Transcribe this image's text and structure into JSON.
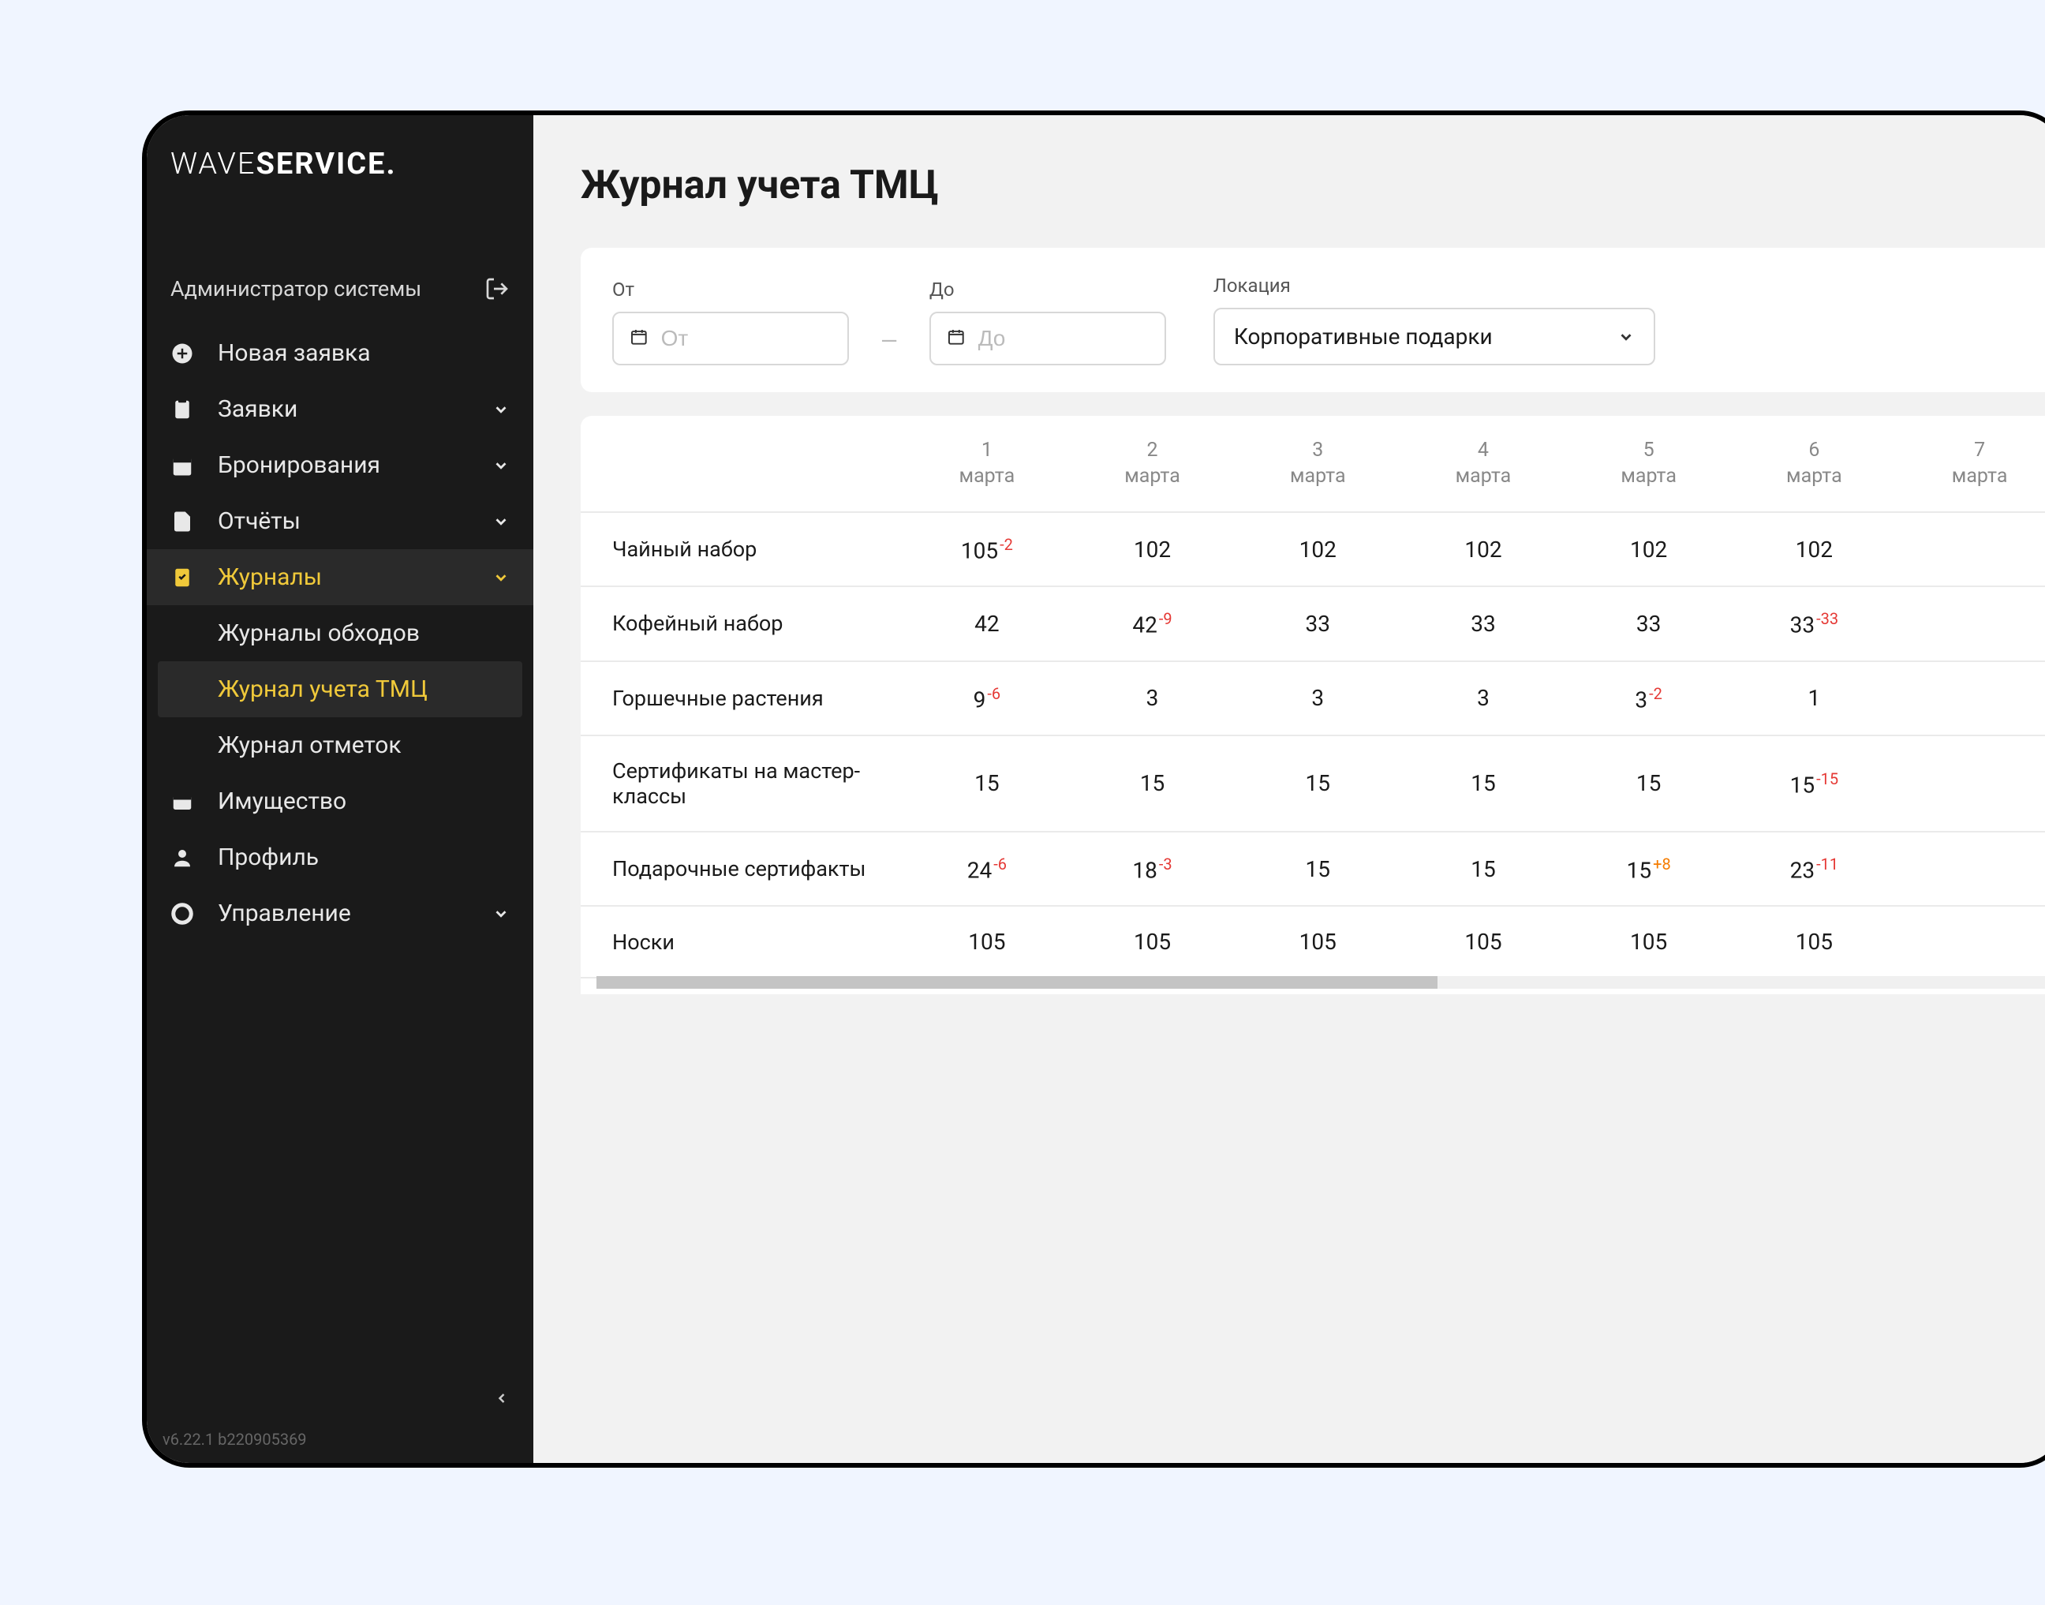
{
  "logo": {
    "pre": "WAVE",
    "bold": "SERVICE",
    "dot": "."
  },
  "user_label": "Администратор системы",
  "nav": {
    "new_request": "Новая заявка",
    "requests": "Заявки",
    "bookings": "Бронирования",
    "reports": "Отчёты",
    "journals": "Журналы",
    "journals_sub": {
      "rounds": "Журналы обходов",
      "tmc": "Журнал учета ТМЦ",
      "marks": "Журнал отметок"
    },
    "property": "Имущество",
    "profile": "Профиль",
    "management": "Управление"
  },
  "version": "v6.22.1 b220905369",
  "page_title": "Журнал учета ТМЦ",
  "filters": {
    "from_label": "От",
    "to_label": "До",
    "from_placeholder": "От",
    "to_placeholder": "До",
    "location_label": "Локация",
    "location_value": "Корпоративные подарки"
  },
  "table": {
    "month": "марта",
    "days": [
      "1",
      "2",
      "3",
      "4",
      "5",
      "6",
      "7"
    ],
    "rows": [
      {
        "name": "Чайный набор",
        "cells": [
          {
            "v": "105",
            "d": "-2"
          },
          {
            "v": "102"
          },
          {
            "v": "102"
          },
          {
            "v": "102"
          },
          {
            "v": "102"
          },
          {
            "v": "102"
          },
          {
            "v": ""
          }
        ]
      },
      {
        "name": "Кофейный набор",
        "cells": [
          {
            "v": "42"
          },
          {
            "v": "42",
            "d": "-9"
          },
          {
            "v": "33"
          },
          {
            "v": "33"
          },
          {
            "v": "33"
          },
          {
            "v": "33",
            "d": "-33"
          },
          {
            "v": ""
          }
        ]
      },
      {
        "name": "Горшечные растения",
        "cells": [
          {
            "v": "9",
            "d": "-6"
          },
          {
            "v": "3"
          },
          {
            "v": "3"
          },
          {
            "v": "3"
          },
          {
            "v": "3",
            "d": "-2"
          },
          {
            "v": "1"
          },
          {
            "v": ""
          }
        ]
      },
      {
        "name": "Сертификаты на мастер-классы",
        "cells": [
          {
            "v": "15"
          },
          {
            "v": "15"
          },
          {
            "v": "15"
          },
          {
            "v": "15"
          },
          {
            "v": "15"
          },
          {
            "v": "15",
            "d": "-15"
          },
          {
            "v": ""
          }
        ]
      },
      {
        "name": "Подарочные сертифакты",
        "cells": [
          {
            "v": "24",
            "d": "-6"
          },
          {
            "v": "18",
            "d": "-3"
          },
          {
            "v": "15"
          },
          {
            "v": "15"
          },
          {
            "v": "15",
            "d": "+8"
          },
          {
            "v": "23",
            "d": "-11"
          },
          {
            "v": ""
          }
        ]
      },
      {
        "name": "Носки",
        "cells": [
          {
            "v": "105"
          },
          {
            "v": "105"
          },
          {
            "v": "105"
          },
          {
            "v": "105"
          },
          {
            "v": "105"
          },
          {
            "v": "105"
          },
          {
            "v": ""
          }
        ]
      }
    ]
  },
  "chart_data": {
    "type": "table",
    "title": "Журнал учета ТМЦ",
    "columns": [
      "1 марта",
      "2 марта",
      "3 марта",
      "4 марта",
      "5 марта",
      "6 марта",
      "7 марта"
    ],
    "rows": [
      {
        "name": "Чайный набор",
        "values": [
          105,
          102,
          102,
          102,
          102,
          102,
          null
        ],
        "deltas": [
          -2,
          null,
          null,
          null,
          null,
          null,
          null
        ]
      },
      {
        "name": "Кофейный набор",
        "values": [
          42,
          42,
          33,
          33,
          33,
          33,
          null
        ],
        "deltas": [
          null,
          -9,
          null,
          null,
          null,
          -33,
          null
        ]
      },
      {
        "name": "Горшечные растения",
        "values": [
          9,
          3,
          3,
          3,
          3,
          1,
          null
        ],
        "deltas": [
          -6,
          null,
          null,
          null,
          -2,
          null,
          null
        ]
      },
      {
        "name": "Сертификаты на мастер-классы",
        "values": [
          15,
          15,
          15,
          15,
          15,
          15,
          null
        ],
        "deltas": [
          null,
          null,
          null,
          null,
          null,
          -15,
          null
        ]
      },
      {
        "name": "Подарочные сертифакты",
        "values": [
          24,
          18,
          15,
          15,
          15,
          23,
          null
        ],
        "deltas": [
          -6,
          -3,
          null,
          null,
          8,
          -11,
          null
        ]
      },
      {
        "name": "Носки",
        "values": [
          105,
          105,
          105,
          105,
          105,
          105,
          null
        ],
        "deltas": [
          null,
          null,
          null,
          null,
          null,
          null,
          null
        ]
      }
    ]
  }
}
